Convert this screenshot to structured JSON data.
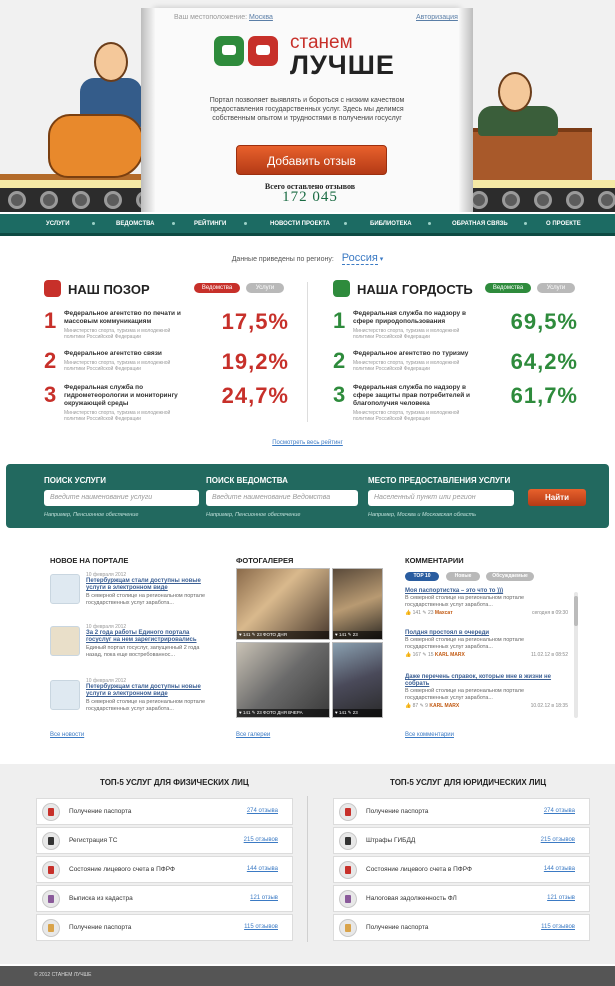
{
  "header": {
    "location_label": "Ваш местоположение:",
    "location_value": "Москва",
    "login_link": "Авторизация",
    "logo_word1": "станем",
    "logo_word2": "ЛУЧШЕ",
    "description": "Портал позволяет выявлять и бороться с низким качеством предоставления государственных услуг. Здесь мы делимся собственным опытом и трудностями в получении госуслуг",
    "add_review_button": "Добавить отзыв",
    "total_label": "Всего оставлено отзывов",
    "total_count": "172 045"
  },
  "nav": {
    "items": [
      "Услуги",
      "Ведомства",
      "Рейтинги",
      "Новости проекта",
      "Библиотека",
      "Обратная связь",
      "О проекте"
    ]
  },
  "region": {
    "label": "Данные приведены по региону:",
    "value": "Россия"
  },
  "shame": {
    "title": "НАШ ПОЗОР",
    "tab_active": "Ведомства",
    "tab_inactive": "Услуги",
    "items": [
      {
        "rank": "1",
        "name": "Федеральное агентство по печати и массовым коммуникациям",
        "ministry": "Министерство спорта, туризма и молодежной политики Российской Федерации",
        "percent": "17,5%"
      },
      {
        "rank": "2",
        "name": "Федеральное агентство связи",
        "ministry": "Министерство спорта, туризма и молодежной политики Российской Федерации",
        "percent": "19,2%"
      },
      {
        "rank": "3",
        "name": "Федеральная служба по гидрометеорологии и мониторингу окружающей среды",
        "ministry": "Министерство спорта, туризма и молодежной политики Российской Федерации",
        "percent": "24,7%"
      }
    ]
  },
  "pride": {
    "title": "НАША ГОРДОСТЬ",
    "tab_active": "Ведомства",
    "tab_inactive": "Услуги",
    "items": [
      {
        "rank": "1",
        "name": "Федеральная служба по надзору в сфере природопользования",
        "ministry": "Министерство спорта, туризма и молодежной политики Российской Федерации",
        "percent": "69,5%"
      },
      {
        "rank": "2",
        "name": "Федеральное агентство по туризму",
        "ministry": "Министерство спорта, туризма и молодежной политики Российской Федерации",
        "percent": "64,2%"
      },
      {
        "rank": "3",
        "name": "Федеральная служба по надзору в сфере защиты прав потребителей и благополучия человека",
        "ministry": "Министерство спорта, туризма и молодежной политики Российской Федерации",
        "percent": "61,7%"
      }
    ]
  },
  "all_rating_link": "Посмотреть весь рейтинг",
  "search": {
    "service_label": "Поиск услуги",
    "service_placeholder": "Введите наименование услуги",
    "service_example": "Например, Пенсионное обеспечение",
    "agency_label": "Поиск ведомства",
    "agency_placeholder": "Введите наименование Ведомства",
    "agency_example": "Например, Пенсионное обеспечение",
    "place_label": "Место предоставления услуги",
    "place_placeholder": "Населенный пункт или регион",
    "place_example": "Например, Москва и Московская область",
    "find_button": "Найти"
  },
  "news": {
    "title": "НОВОЕ НА ПОРТАЛЕ",
    "items": [
      {
        "date": "10 февраля 2012",
        "title": "Петербуржцам стали доступны новые услуги в электронном виде",
        "text": "В северной столице на региональном портале государственных услуг заработа..."
      },
      {
        "date": "10 февраля 2012",
        "title": "За 2 года работы Единого портала госуслуг на нем зарегистрировались",
        "text": "Единый портал госуслуг, запущенный 2 года назад, пока еще востребованнос..."
      },
      {
        "date": "10 февраля 2012",
        "title": "Петербуржцам стали доступны новые услуги в электронном виде",
        "text": "В северной столице на региональном портале государственных услуг заработа..."
      }
    ],
    "all_link": "Все новости"
  },
  "gallery": {
    "title": "ФОТОГАЛЕРЕЯ",
    "photos": [
      {
        "likes": "141",
        "comments": "23",
        "caption": "ФОТО ДНЯ"
      },
      {
        "likes": "141",
        "comments": "23",
        "caption": ""
      },
      {
        "likes": "141",
        "comments": "23",
        "caption": "ФОТО ДНЯ ВЧЕРА"
      },
      {
        "likes": "141",
        "comments": "23",
        "caption": ""
      }
    ],
    "all_link": "Все галереи"
  },
  "comments": {
    "title": "КОММЕНТАРИИ",
    "tabs": [
      "TOP 10",
      "Новые",
      "Обсуждаемые"
    ],
    "items": [
      {
        "title": "Моя паспортистка – это что то )))",
        "text": "В северной столице на региональном портале государственных услуг заработа...",
        "likes": "141",
        "comments": "23",
        "author": "Махсат",
        "time": "сегодня в 09:30"
      },
      {
        "title": "Полдня простоял в очереди",
        "text": "В северной столице на региональном портале государственных услуг заработа...",
        "likes": "167",
        "comments": "15",
        "author": "KARL MARX",
        "time": "11.02.12 в 08:52"
      },
      {
        "title": "Даже перечень справок, которые мне в жизни не собрать",
        "text": "В северной столице на региональном портале государственных услуг заработа...",
        "likes": "87",
        "comments": "9",
        "author": "KARL MARX",
        "time": "10.02.12 в 18:35"
      }
    ],
    "all_link": "Все комментарии"
  },
  "top_individuals": {
    "title": "ТОП-5 УСЛУГ ДЛЯ ФИЗИЧЕСКИХ ЛИЦ",
    "items": [
      {
        "name": "Получение паспорта",
        "count": "274 отзыва",
        "icon": "passport-icon"
      },
      {
        "name": "Регистрация ТС",
        "count": "215 отзывов",
        "icon": "traffic-light-icon"
      },
      {
        "name": "Состояние лицевого счета в ПФРФ",
        "count": "144 отзыва",
        "icon": "pension-icon"
      },
      {
        "name": "Выписка из кадастра",
        "count": "121 отзыв",
        "icon": "cadastre-icon"
      },
      {
        "name": "Получение паспорта",
        "count": "115 отзывов",
        "icon": "passport-icon"
      }
    ]
  },
  "top_legal": {
    "title": "ТОП-5 УСЛУГ ДЛЯ ЮРИДИЧЕСКИХ ЛИЦ",
    "items": [
      {
        "name": "Получение паспорта",
        "count": "274 отзыва",
        "icon": "passport-icon"
      },
      {
        "name": "Штрафы ГИБДД",
        "count": "215 отзывов",
        "icon": "traffic-light-icon"
      },
      {
        "name": "Состояние лицевого счета в ПФРФ",
        "count": "144 отзыва",
        "icon": "pension-icon"
      },
      {
        "name": "Налоговая задолженность ФЛ",
        "count": "121 отзыв",
        "icon": "tax-icon"
      },
      {
        "name": "Получение паспорта",
        "count": "115 отзывов",
        "icon": "passport-icon"
      }
    ]
  },
  "footer": {
    "copyright": "© 2012 СТАНЕМ ЛУЧШЕ"
  },
  "colors": {
    "nav_green": "#1c6b63",
    "shame_red": "#c7302a",
    "pride_green": "#2e8b3c",
    "accent_orange": "#e8612c",
    "link_blue": "#3b7ac4"
  }
}
